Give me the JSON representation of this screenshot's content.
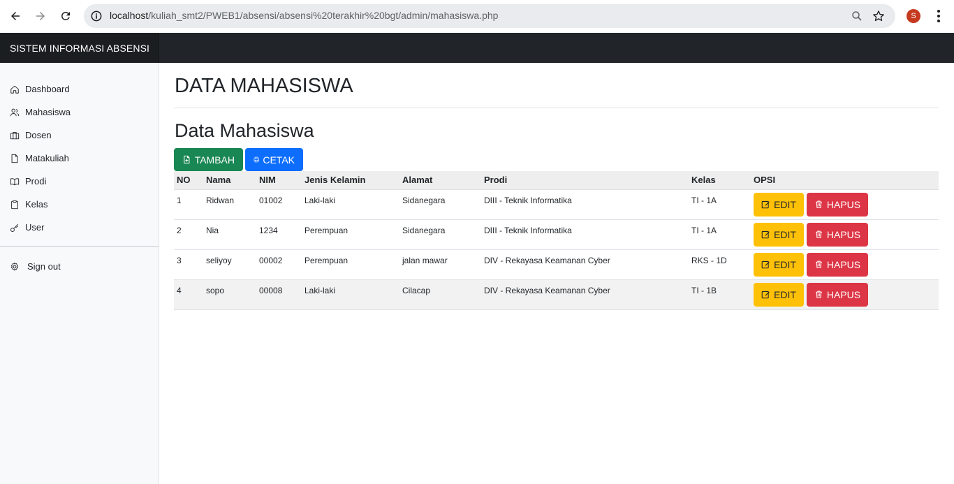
{
  "browser": {
    "url_host": "localhost",
    "url_path": "/kuliah_smt2/PWEB1/absensi/absensi%20terakhir%20bgt/admin/mahasiswa.php",
    "profile_initial": "S"
  },
  "navbar": {
    "brand": "SISTEM INFORMASI ABSENSI"
  },
  "sidebar": {
    "items": [
      {
        "label": "Dashboard",
        "icon": "home-icon"
      },
      {
        "label": "Mahasiswa",
        "icon": "users-icon"
      },
      {
        "label": "Dosen",
        "icon": "briefcase-icon"
      },
      {
        "label": "Matakuliah",
        "icon": "file-icon"
      },
      {
        "label": "Prodi",
        "icon": "book-open-icon"
      },
      {
        "label": "Kelas",
        "icon": "clipboard-icon"
      },
      {
        "label": "User",
        "icon": "key-icon"
      }
    ],
    "signout": {
      "label": "Sign out",
      "icon": "gear-icon"
    }
  },
  "main": {
    "page_title": "DATA MAHASISWA",
    "section_title": "Data Mahasiswa",
    "tambah_label": "TAMBAH",
    "cetak_label": "CETAK",
    "table": {
      "headers": [
        "NO",
        "Nama",
        "NIM",
        "Jenis Kelamin",
        "Alamat",
        "Prodi",
        "Kelas",
        "OPSI"
      ],
      "rows": [
        {
          "no": "1",
          "nama": "Ridwan",
          "nim": "01002",
          "jk": "Laki-laki",
          "alamat": "Sidanegara",
          "prodi": "DIII - Teknik Informatika",
          "kelas": "TI - 1A"
        },
        {
          "no": "2",
          "nama": "Nia",
          "nim": "1234",
          "jk": "Perempuan",
          "alamat": "Sidanegara",
          "prodi": "DIII - Teknik Informatika",
          "kelas": "TI - 1A"
        },
        {
          "no": "3",
          "nama": "seliyoy",
          "nim": "00002",
          "jk": "Perempuan",
          "alamat": "jalan mawar",
          "prodi": "DIV - Rekayasa Keamanan Cyber",
          "kelas": "RKS - 1D"
        },
        {
          "no": "4",
          "nama": "sopo",
          "nim": "00008",
          "jk": "Laki-laki",
          "alamat": "Cilacap",
          "prodi": "DIV - Rekayasa Keamanan Cyber",
          "kelas": "TI - 1B"
        }
      ],
      "edit_label": "EDIT",
      "hapus_label": "HAPUS"
    }
  },
  "colors": {
    "navbar": "#212529",
    "tambah": "#198754",
    "cetak": "#0d6efd",
    "edit": "#ffc107",
    "hapus": "#dc3545"
  }
}
